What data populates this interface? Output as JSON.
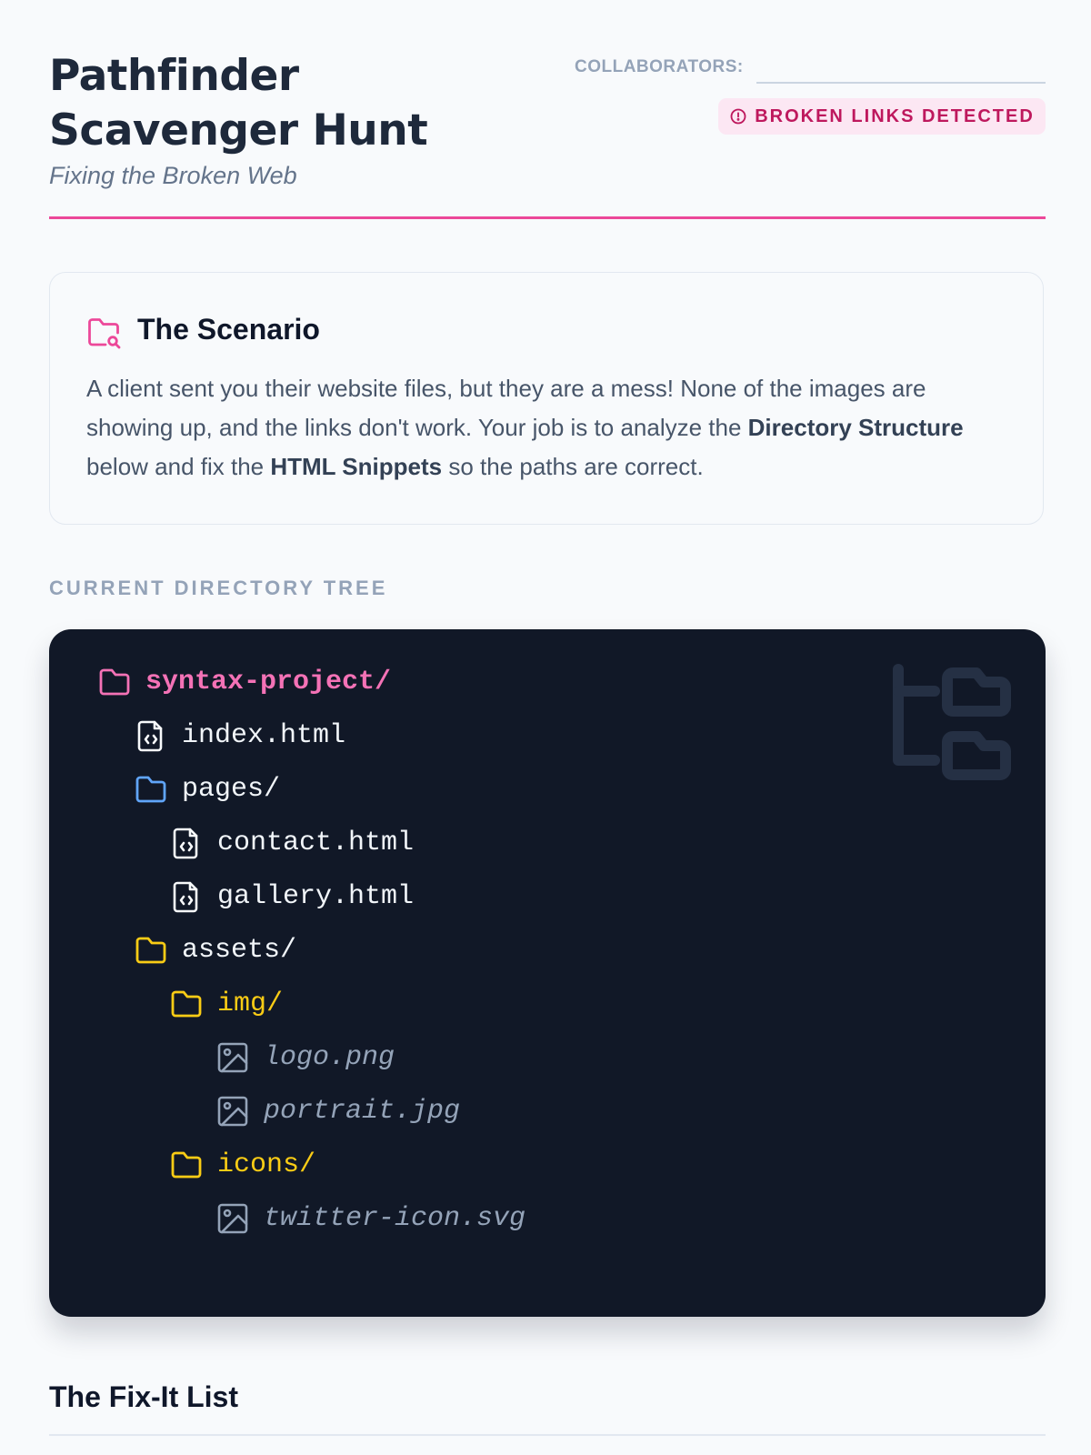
{
  "header": {
    "title": "Pathfinder Scavenger Hunt",
    "subtitle": "Fixing the Broken Web",
    "collaborators_label": "COLLABORATORS:",
    "badge": "BROKEN LINKS DETECTED"
  },
  "scenario": {
    "title": "The Scenario",
    "text_part1": "A client sent you their website files, but they are a mess! None of the images are showing up, and the links don't work. Your job is to analyze the ",
    "bold1": "Directory Structure",
    "text_part2": " below and fix the ",
    "bold2": "HTML Snippets",
    "text_part3": " so the paths are correct."
  },
  "tree_section_label": "CURRENT DIRECTORY TREE",
  "tree": {
    "items": [
      {
        "name": "syntax-project/",
        "icon": "folder-icon"
      },
      {
        "name": "index.html",
        "icon": "html-file-icon"
      },
      {
        "name": "pages/",
        "icon": "folder-icon"
      },
      {
        "name": "contact.html",
        "icon": "html-file-icon"
      },
      {
        "name": "gallery.html",
        "icon": "html-file-icon"
      },
      {
        "name": "assets/",
        "icon": "folder-icon"
      },
      {
        "name": "img/",
        "icon": "folder-icon"
      },
      {
        "name": "logo.png",
        "icon": "image-file-icon"
      },
      {
        "name": "portrait.jpg",
        "icon": "image-file-icon"
      },
      {
        "name": "icons/",
        "icon": "folder-icon"
      },
      {
        "name": "twitter-icon.svg",
        "icon": "image-file-icon"
      }
    ]
  },
  "colors": {
    "accent": "#ec4899",
    "tree_bg": "#111827",
    "folder_blue": "#60a5fa",
    "folder_yellow": "#facc15"
  },
  "fix_list_title": "The Fix-It List"
}
